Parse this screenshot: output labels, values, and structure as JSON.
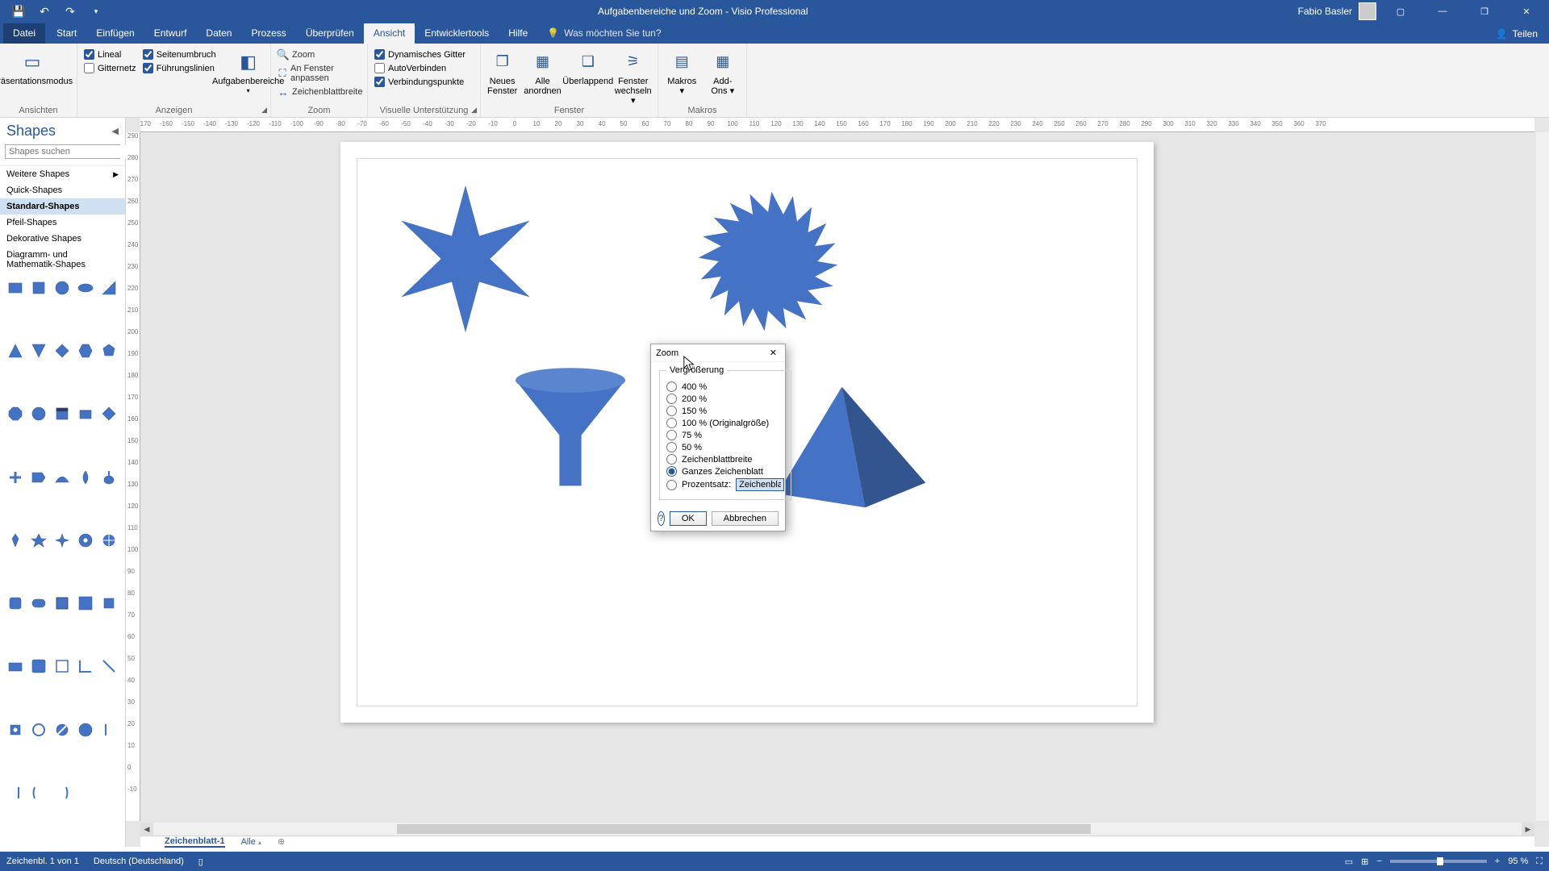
{
  "title": "Aufgabenbereiche und Zoom  -  Visio Professional",
  "user": "Fabio Basler",
  "menus": {
    "file": "Datei",
    "tabs": [
      "Start",
      "Einfügen",
      "Entwurf",
      "Daten",
      "Prozess",
      "Überprüfen",
      "Ansicht",
      "Entwicklertools",
      "Hilfe"
    ],
    "active": "Ansicht",
    "tellme": "Was möchten Sie tun?",
    "share": "Teilen"
  },
  "ribbon": {
    "ansichten": {
      "label": "Ansichten",
      "btn": "Präsentationsmodus"
    },
    "anzeigen": {
      "label": "Anzeigen",
      "col1": [
        {
          "c": true,
          "t": "Lineal"
        },
        {
          "c": false,
          "t": "Gitternetz"
        }
      ],
      "col2": [
        {
          "c": true,
          "t": "Seitenumbruch"
        },
        {
          "c": true,
          "t": "Führungslinien"
        }
      ],
      "btn": "Aufgabenbereiche"
    },
    "zoom": {
      "label": "Zoom",
      "items": [
        "Zoom",
        "An Fenster anpassen",
        "Zeichenblattbreite"
      ]
    },
    "visuell": {
      "label": "Visuelle Unterstützung",
      "items": [
        {
          "c": true,
          "t": "Dynamisches Gitter"
        },
        {
          "c": false,
          "t": "AutoVerbinden"
        },
        {
          "c": true,
          "t": "Verbindungspunkte"
        }
      ]
    },
    "fenster": {
      "label": "Fenster",
      "btns": [
        "Neues Fenster",
        "Alle anordnen",
        "Überlappend",
        "Fenster wechseln"
      ]
    },
    "makros": {
      "label": "Makros",
      "btns": [
        "Makros",
        "Add-Ons"
      ]
    }
  },
  "shapes": {
    "title": "Shapes",
    "search": "Shapes suchen",
    "stencils": [
      {
        "t": "Weitere Shapes",
        "arrow": true
      },
      {
        "t": "Quick-Shapes"
      },
      {
        "t": "Standard-Shapes",
        "sel": true
      },
      {
        "t": "Pfeil-Shapes"
      },
      {
        "t": "Dekorative Shapes"
      },
      {
        "t": "Diagramm- und Mathematik-Shapes"
      }
    ]
  },
  "pageTabs": {
    "active": "Zeichenblatt-1",
    "all": "Alle"
  },
  "status": {
    "page": "Zeichenbl. 1 von 1",
    "lang": "Deutsch (Deutschland)",
    "zoom": "95 %"
  },
  "dialog": {
    "title": "Zoom",
    "legend": "Vergrößerung",
    "opts": [
      "400 %",
      "200 %",
      "150 %",
      "100 % (Originalgröße)",
      "75 %",
      "50 %",
      "Zeichenblattbreite",
      "Ganzes Zeichenblatt"
    ],
    "selected": "Ganzes Zeichenblatt",
    "pctLabel": "Prozentsatz:",
    "pctValue": "Zeichenblatt",
    "ok": "OK",
    "cancel": "Abbrechen"
  },
  "ruler_h": [
    "-170",
    "-160",
    "-150",
    "-140",
    "-130",
    "-120",
    "-110",
    "-100",
    "-90",
    "-80",
    "-70",
    "-60",
    "-50",
    "-40",
    "-30",
    "-20",
    "-10",
    "0",
    "10",
    "20",
    "30",
    "40",
    "50",
    "60",
    "70",
    "80",
    "90",
    "100",
    "110",
    "120",
    "130",
    "140",
    "150",
    "160",
    "170",
    "180",
    "190",
    "200",
    "210",
    "220",
    "230",
    "240",
    "250",
    "260",
    "270",
    "280",
    "290",
    "300",
    "310",
    "320",
    "330",
    "340",
    "350",
    "360",
    "370"
  ],
  "ruler_v": [
    "290",
    "280",
    "270",
    "260",
    "250",
    "240",
    "230",
    "220",
    "210",
    "200",
    "190",
    "180",
    "170",
    "160",
    "150",
    "140",
    "130",
    "120",
    "110",
    "100",
    "90",
    "80",
    "70",
    "60",
    "50",
    "40",
    "30",
    "20",
    "10",
    "0",
    "-10"
  ]
}
